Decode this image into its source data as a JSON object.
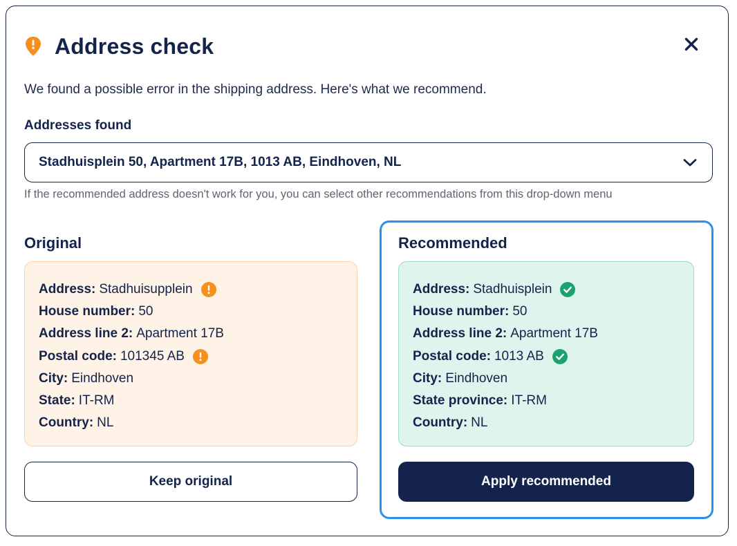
{
  "colors": {
    "primary": "#13234b",
    "warning": "#f5901e",
    "success": "#1aa36f",
    "focus": "#2b8ff2",
    "original_bg": "#fff2e6",
    "recommended_bg": "#e0f4ee"
  },
  "header": {
    "icon": "warning-pin-icon",
    "title": "Address check",
    "close_icon": "close-icon"
  },
  "description": "We found a possible error in the shipping address. Here's what we recommend.",
  "addresses_found": {
    "label": "Addresses found",
    "selected": "Stadhuisplein 50, Apartment 17B, 1013 AB, Eindhoven, NL",
    "hint": "If the recommended address doesn't work for you, you can select other recommendations from this drop-down menu"
  },
  "original": {
    "title": "Original",
    "fields": [
      {
        "label": "Address:",
        "value": "Stadhuisupplein",
        "flag": "warning-icon"
      },
      {
        "label": "House number:",
        "value": "50"
      },
      {
        "label": "Address line 2:",
        "value": "Apartment 17B"
      },
      {
        "label": "Postal code:",
        "value": "101345 AB",
        "flag": "warning-icon"
      },
      {
        "label": "City:",
        "value": "Eindhoven"
      },
      {
        "label": "State:",
        "value": "IT-RM"
      },
      {
        "label": "Country:",
        "value": "NL"
      }
    ],
    "button": "Keep original"
  },
  "recommended": {
    "title": "Recommended",
    "fields": [
      {
        "label": "Address:",
        "value": "Stadhuisplein",
        "flag": "check-icon"
      },
      {
        "label": "House number:",
        "value": "50"
      },
      {
        "label": "Address line 2:",
        "value": "Apartment 17B"
      },
      {
        "label": "Postal code:",
        "value": "1013 AB",
        "flag": "check-icon"
      },
      {
        "label": "City:",
        "value": "Eindhoven"
      },
      {
        "label": "State province:",
        "value": "IT-RM"
      },
      {
        "label": "Country:",
        "value": "NL"
      }
    ],
    "button": "Apply recommended"
  }
}
